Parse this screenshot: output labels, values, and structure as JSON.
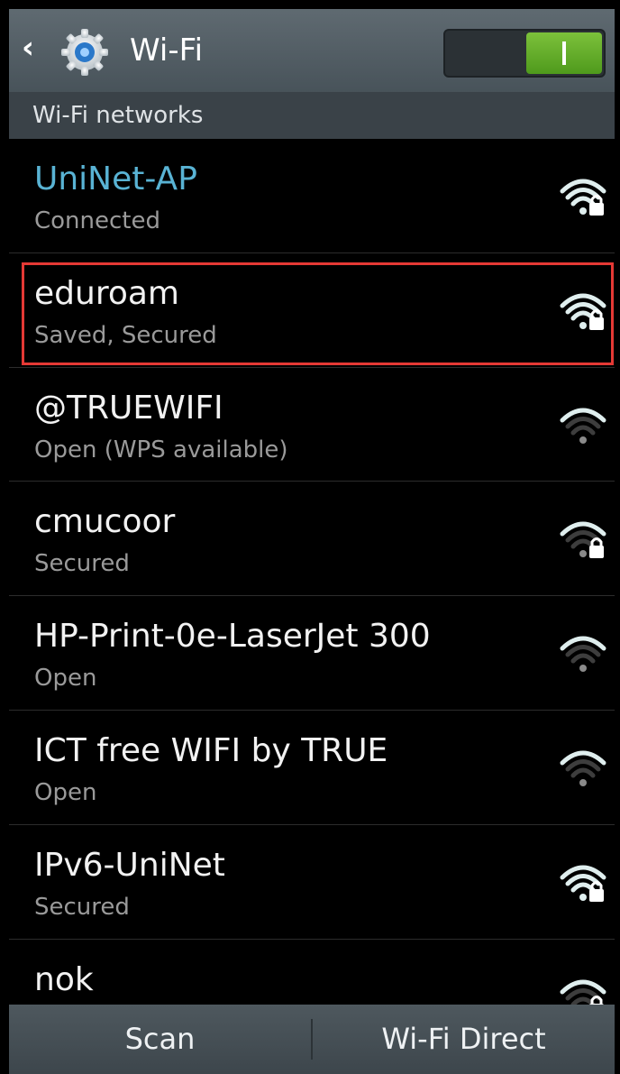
{
  "header": {
    "back_glyph": "‹",
    "title": "Wi-Fi",
    "toggle_label": "I",
    "toggle_on": true,
    "icon": "settings-gear-icon"
  },
  "section": {
    "label": "Wi-Fi networks"
  },
  "networks": [
    {
      "name": "UniNet-AP",
      "status": "Connected",
      "connected": true,
      "locked": true,
      "signal": 3,
      "icon": "wifi-lock-icon"
    },
    {
      "name": "eduroam",
      "status": "Saved, Secured",
      "locked": true,
      "signal": 3,
      "highlighted": true,
      "icon": "wifi-lock-icon"
    },
    {
      "name": "@TRUEWIFI",
      "status": "Open (WPS available)",
      "locked": false,
      "signal": 1,
      "icon": "wifi-icon"
    },
    {
      "name": "cmucoor",
      "status": "Secured",
      "locked": true,
      "signal": 1,
      "icon": "wifi-lock-icon"
    },
    {
      "name": "HP-Print-0e-LaserJet 300",
      "status": "Open",
      "locked": false,
      "signal": 1,
      "icon": "wifi-icon"
    },
    {
      "name": "ICT free WIFI by TRUE",
      "status": "Open",
      "locked": false,
      "signal": 1,
      "icon": "wifi-icon"
    },
    {
      "name": "IPv6-UniNet",
      "status": "Secured",
      "locked": true,
      "signal": 3,
      "icon": "wifi-lock-icon"
    },
    {
      "name": "nok",
      "status": "",
      "locked": true,
      "signal": 1,
      "icon": "wifi-lock-icon"
    }
  ],
  "bottom": {
    "scan_label": "Scan",
    "direct_label": "Wi-Fi Direct"
  },
  "colors": {
    "connected": "#59b3d4",
    "highlight": "#e53935",
    "toggle_on": "#6fb52f"
  }
}
